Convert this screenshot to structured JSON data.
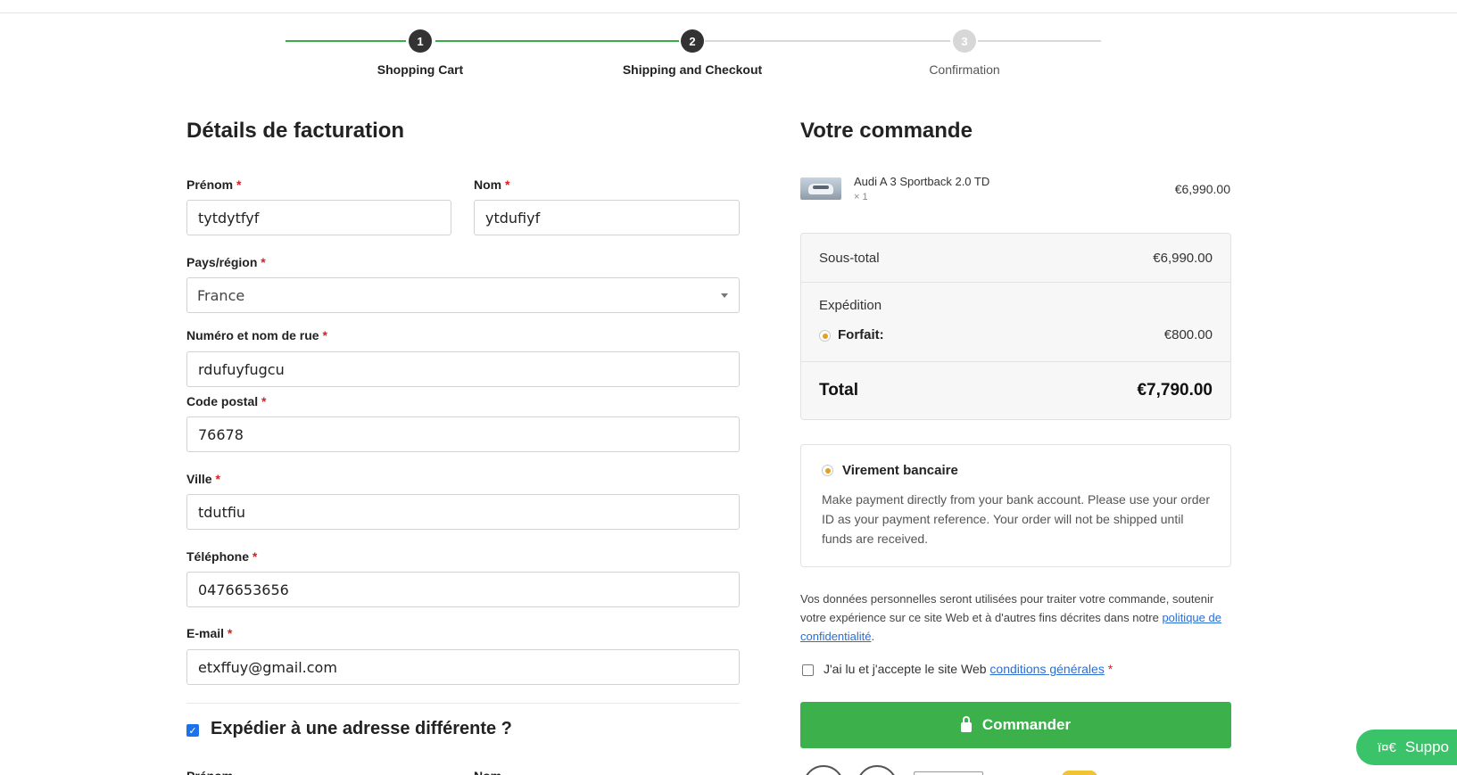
{
  "stepper": {
    "steps": [
      {
        "number": "1",
        "label": "Shopping Cart",
        "state": "done"
      },
      {
        "number": "2",
        "label": "Shipping and Checkout",
        "state": "active"
      },
      {
        "number": "3",
        "label": "Confirmation",
        "state": "pending"
      }
    ]
  },
  "billing": {
    "title": "Détails de facturation",
    "required_mark": "*",
    "fields": {
      "first_name": {
        "label": "Prénom",
        "value": "tytdytfyf"
      },
      "last_name": {
        "label": "Nom",
        "value": "ytdufiyf"
      },
      "country": {
        "label": "Pays/région",
        "value": "France"
      },
      "street": {
        "label": "Numéro et nom de rue",
        "value": "rdufuyfugcu"
      },
      "postcode": {
        "label": "Code postal",
        "value": "76678"
      },
      "city": {
        "label": "Ville",
        "value": "tdutfiu"
      },
      "phone": {
        "label": "Téléphone",
        "value": "0476653656"
      },
      "email": {
        "label": "E-mail",
        "value": "etxffuy@gmail.com"
      }
    },
    "ship_different": {
      "label": "Expédier à une adresse différente ?",
      "checked": true
    }
  },
  "order": {
    "title": "Votre commande",
    "product": {
      "name": "Audi A 3 Sportback 2.0 TD",
      "qty": "× 1",
      "price": "€6,990.00",
      "thumbnail_icon": "car-photo"
    },
    "subtotal": {
      "label": "Sous-total",
      "value": "€6,990.00"
    },
    "shipping": {
      "label": "Expédition",
      "option_label": "Forfait:",
      "option_value": "€800.00"
    },
    "total": {
      "label": "Total",
      "value": "€7,790.00"
    },
    "payment": {
      "title": "Virement bancaire",
      "description": "Make payment directly from your bank account. Please use your order ID as your payment reference. Your order will not be shipped until funds are received."
    },
    "privacy": {
      "text_before": "Vos données personnelles seront utilisées pour traiter votre commande, soutenir votre expérience sur ce site Web et à d'autres fins décrites dans notre ",
      "link": "politique de confidentialité",
      "text_after": "."
    },
    "terms": {
      "text": "J'ai lu et j'accepte le site Web ",
      "link": "conditions générales",
      "required_mark": "*"
    },
    "submit_label": "Commander"
  },
  "support": {
    "icon": "ï¤€",
    "label": "Suppo"
  },
  "colors": {
    "accent_green": "#3bb04b",
    "required_red": "#d81f26",
    "radio_orange": "#e5a020",
    "link_blue": "#2a6ed5"
  }
}
